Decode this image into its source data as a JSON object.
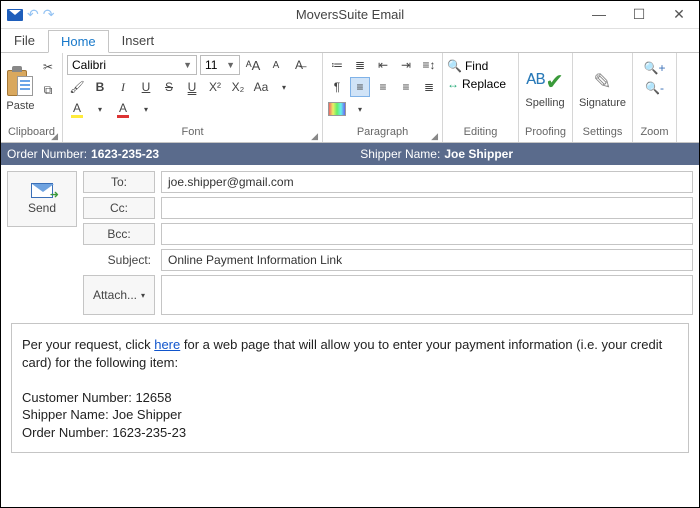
{
  "window": {
    "title": "MoversSuite Email"
  },
  "tabs": {
    "file": "File",
    "home": "Home",
    "insert": "Insert"
  },
  "ribbon": {
    "clipboard": {
      "label": "Clipboard",
      "paste": "Paste"
    },
    "font": {
      "label": "Font",
      "family": "Calibri",
      "size": "11",
      "b": "B",
      "i": "I",
      "u": "U",
      "s": "S",
      "x2": "X²",
      "x_": "X₂",
      "aa": "Aa"
    },
    "paragraph": {
      "label": "Paragraph"
    },
    "editing": {
      "label": "Editing",
      "find": "Find",
      "replace": "Replace"
    },
    "proofing": {
      "label": "Proofing",
      "spelling": "Spelling"
    },
    "settings": {
      "label": "Settings",
      "signature": "Signature"
    },
    "zoom": {
      "label": "Zoom"
    }
  },
  "info": {
    "order_label": "Order Number:",
    "order_value": "1623-235-23",
    "shipper_label": "Shipper Name:",
    "shipper_value": "Joe Shipper"
  },
  "compose": {
    "send": "Send",
    "to_label": "To:",
    "to_value": "joe.shipper@gmail.com",
    "cc_label": "Cc:",
    "cc_value": "",
    "bcc_label": "Bcc:",
    "bcc_value": "",
    "subject_label": "Subject:",
    "subject_value": "Online Payment Information Link",
    "attach_label": "Attach...",
    "attach_value": ""
  },
  "body": {
    "prefix": "Per your request, click ",
    "link": "here",
    "suffix": " for a web page that will allow you to enter your payment information (i.e. your credit card) for the following item:",
    "customer_label": "Customer Number:",
    "customer_value": "12658",
    "shipper_label": "Shipper Name:",
    "shipper_value": "Joe Shipper",
    "order_label": "Order Number:",
    "order_value": "1623-235-23"
  }
}
